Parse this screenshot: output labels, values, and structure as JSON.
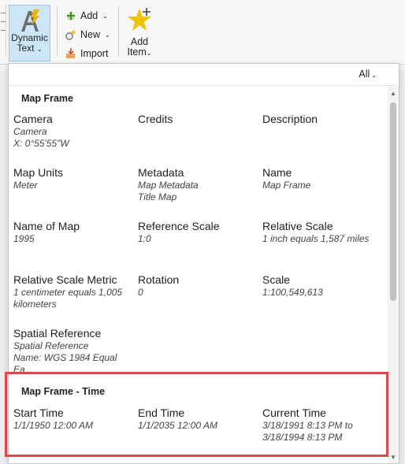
{
  "ribbon": {
    "dynamic_text": "Dynamic Text",
    "add": "Add",
    "new": "New",
    "import": "Import",
    "add_item_1": "Add",
    "add_item_2": "Item"
  },
  "filter": "All",
  "sections": [
    {
      "title": "Map Frame",
      "items": [
        {
          "title": "Camera",
          "value": "Camera\nX: 0°55'55\"W"
        },
        {
          "title": "Credits",
          "value": ""
        },
        {
          "title": "Description",
          "value": ""
        },
        {
          "title": "Map Units",
          "value": "Meter"
        },
        {
          "title": "Metadata",
          "value": "Map Metadata\nTitle Map"
        },
        {
          "title": "Name",
          "value": "Map Frame"
        },
        {
          "title": "Name of Map",
          "value": "1995"
        },
        {
          "title": "Reference Scale",
          "value": "1:0"
        },
        {
          "title": "Relative Scale",
          "value": "1 inch equals 1,587 miles"
        },
        {
          "title": "Relative Scale Metric",
          "value": "1 centimeter equals 1,005\nkilometers"
        },
        {
          "title": "Rotation",
          "value": "0"
        },
        {
          "title": "Scale",
          "value": "1:100,549,613"
        },
        {
          "title": "Spatial Reference",
          "value": "Spatial Reference\nName: WGS 1984 Equal Ea..."
        }
      ]
    },
    {
      "title": "Map Frame - Time",
      "items": [
        {
          "title": "Start Time",
          "value": "1/1/1950 12:00 AM"
        },
        {
          "title": "End Time",
          "value": "1/1/2035 12:00 AM"
        },
        {
          "title": "Current Time",
          "value": "3/18/1991 8:13 PM to\n3/18/1994 8:13 PM"
        }
      ]
    }
  ],
  "colors": {
    "accent_selected": "#cde6f7",
    "highlight_box": "#e0474c"
  }
}
